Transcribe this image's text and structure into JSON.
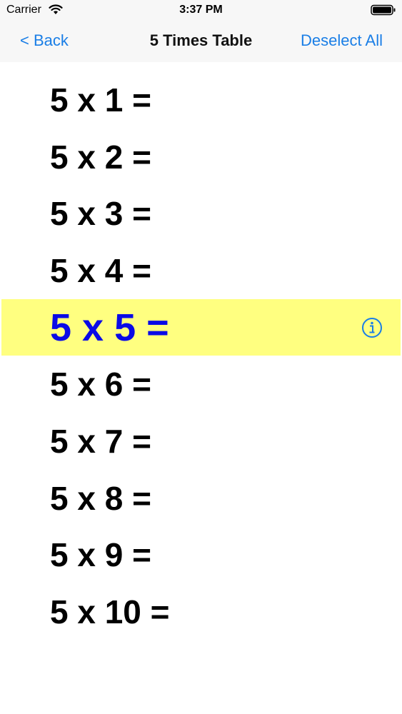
{
  "status_bar": {
    "carrier": "Carrier",
    "time": "3:37 PM"
  },
  "nav": {
    "back_label": "< Back",
    "title": "5 Times Table",
    "deselect_label": "Deselect All"
  },
  "rows": [
    {
      "label": "5 x 1 ="
    },
    {
      "label": "5 x 2 ="
    },
    {
      "label": "5 x 3 ="
    },
    {
      "label": "5 x 4 ="
    },
    {
      "label": "5 x 5 =",
      "selected": true
    },
    {
      "label": "5 x 6 ="
    },
    {
      "label": "5 x 7 ="
    },
    {
      "label": "5 x 8 ="
    },
    {
      "label": "5 x 9 ="
    },
    {
      "label": "5 x 10 ="
    }
  ],
  "colors": {
    "accent": "#1a7ee6",
    "selected_background": "#ffff80",
    "selected_text": "#0a0ae6"
  },
  "icons": {
    "wifi": "wifi-icon",
    "battery": "battery-icon",
    "info": "info-icon"
  }
}
